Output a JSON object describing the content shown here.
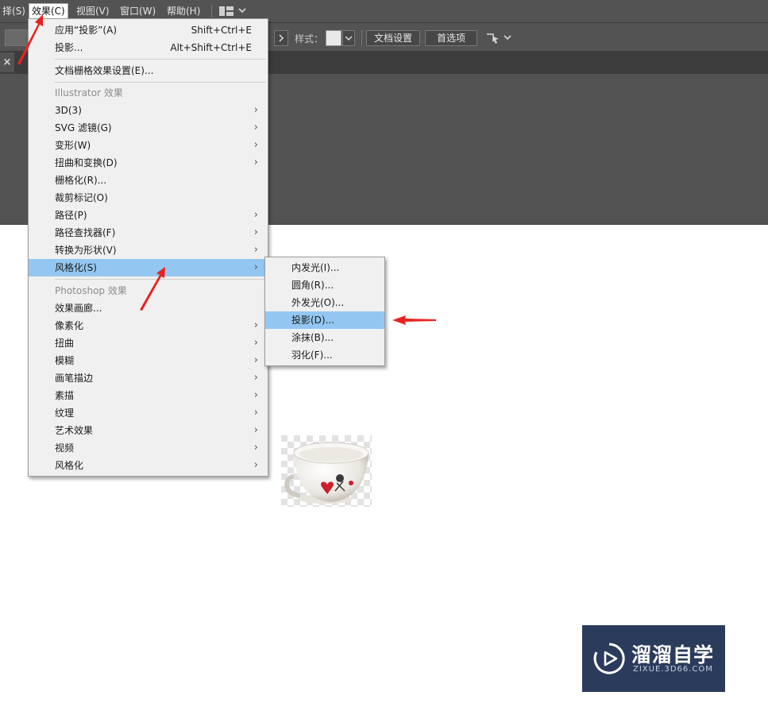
{
  "menubar": {
    "items": [
      "择(S)",
      "效果(C)",
      "视图(V)",
      "窗口(W)",
      "帮助(H)"
    ]
  },
  "controlbar": {
    "style_label": "样式：",
    "doc_settings_button": "文档设置",
    "preferences_button": "首选项"
  },
  "tab": {
    "close_glyph": "×"
  },
  "effects_menu": {
    "apply_last": {
      "label": "应用“投影”(A)",
      "shortcut": "Shift+Ctrl+E"
    },
    "last_effect": {
      "label": "投影...",
      "shortcut": "Alt+Shift+Ctrl+E"
    },
    "doc_raster": "文档栅格效果设置(E)...",
    "illustrator_header": "Illustrator 效果",
    "illustrator_items": [
      "3D(3)",
      "SVG 滤镜(G)",
      "变形(W)",
      "扭曲和变换(D)",
      "栅格化(R)...",
      "裁剪标记(O)",
      "路径(P)",
      "路径查找器(F)",
      "转换为形状(V)",
      "风格化(S)"
    ],
    "photoshop_header": "Photoshop 效果",
    "photoshop_items": [
      "效果画廊...",
      "像素化",
      "扭曲",
      "模糊",
      "画笔描边",
      "素描",
      "纹理",
      "艺术效果",
      "视频",
      "风格化"
    ]
  },
  "stylize_submenu": {
    "items": [
      "内发光(I)...",
      "圆角(R)...",
      "外发光(O)...",
      "投影(D)...",
      "涂抹(B)...",
      "羽化(F)..."
    ],
    "highlighted_index": 3
  },
  "watermark": {
    "title": "溜溜自学",
    "url": "ZIXUE.3D66.COM"
  },
  "colors": {
    "highlight": "#93c7f1",
    "annotation_arrow": "#e8231f",
    "chrome": "#535353"
  }
}
